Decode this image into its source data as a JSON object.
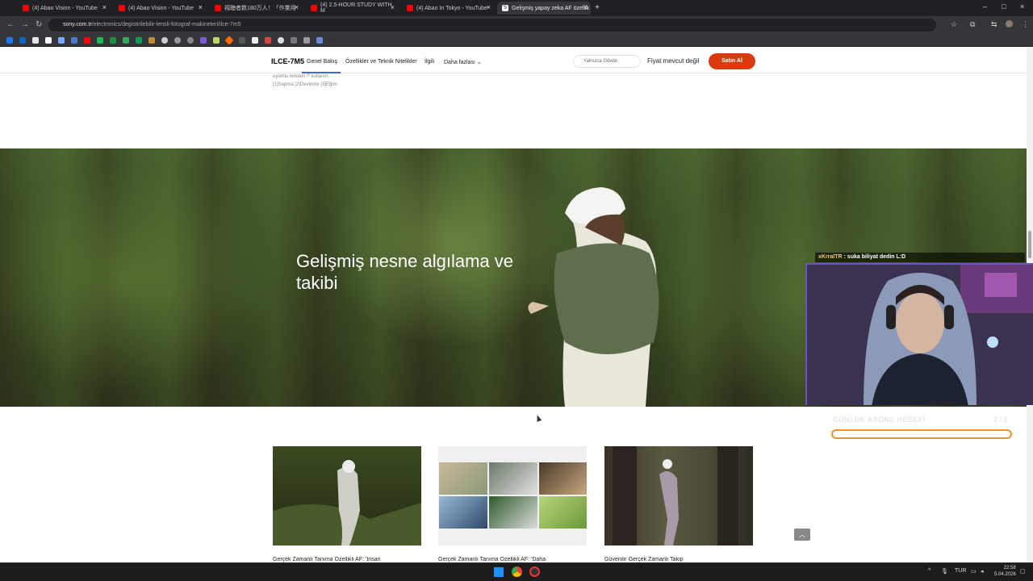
{
  "browser": {
    "tabs": [
      {
        "label": "(4) Abao Vision - YouTube",
        "favicon_color": "#ff0000"
      },
      {
        "label": "(4) Abao Vision - YouTube",
        "favicon_color": "#ff0000"
      },
      {
        "label": "視聴者数180万人！「作業用",
        "favicon_color": "#ff0000"
      },
      {
        "label": "(4) 2.5-HOUR STUDY WITH M",
        "favicon_color": "#ff0000"
      },
      {
        "label": "(4) Abao In Tokyo - YouTube",
        "favicon_color": "#ff0000"
      },
      {
        "label": "Gelişmiş yapay zeka AF özellik",
        "favicon_color": "#ffffff"
      }
    ],
    "new_tab": "+",
    "url_domain": "sony.com.tr",
    "url_path": "/electronics/degistirilebilir-lensli-fotograf-makineleri/ilce-7m5"
  },
  "product_nav": {
    "model": "ILCE-7M5",
    "items": [
      "Genel Bakış",
      "Özellikler ve Teknik Nitelikler",
      "İlgili",
      "Daha fazlası"
    ],
    "select_value": "Yalnızca Gövde",
    "price_text": "Fiyat mevcut değil",
    "buy_label": "Satın Al"
  },
  "footnote": {
    "line1": "uyumlu lensleri ²⁰ kullanın.",
    "line2": "[1]Sapma [2]Devinme [3]Eğim"
  },
  "hero": {
    "title": "Gelişmiş nesne algılama ve takibi"
  },
  "cards": [
    {
      "caption": "Gerçek Zamanlı Tanıma Özellikli AF: 'İnsan"
    },
    {
      "caption": "Gerçek Zamanlı Tanıma Özellikli AF: 'Daha"
    },
    {
      "caption": "Güvenilir Gerçek Zamanlı Takip"
    }
  ],
  "stream_overlay": {
    "chat_user": "xKrralTR",
    "chat_message": ": suka biliyat dedin L:D",
    "goal_label": "GÜNLÜK ABONE HEDEFİ",
    "goal_count": "2 / 3"
  },
  "taskbar": {
    "lang": "TUR",
    "time": "22:58",
    "date": "5.04.2026"
  },
  "colors": {
    "buy_button": "#d93b0e",
    "nav_underline": "#3b6bd6",
    "goal_bar_border": "#f0922a"
  }
}
